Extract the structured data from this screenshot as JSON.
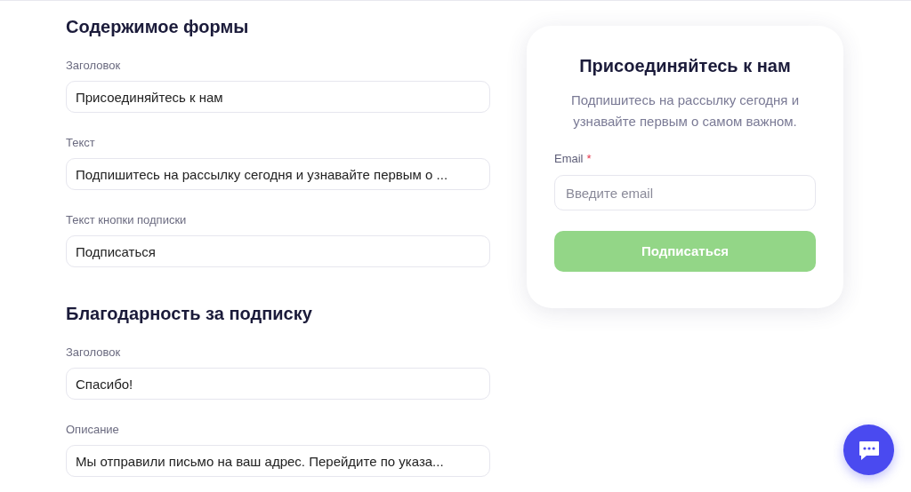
{
  "sections": [
    {
      "title": "Содержимое формы",
      "fields": [
        {
          "label": "Заголовок",
          "value": "Присоединяйтесь к нам"
        },
        {
          "label": "Текст",
          "value": "Подпишитесь на рассылку сегодня и узнавайте первым о ..."
        },
        {
          "label": "Текст кнопки подписки",
          "value": "Подписаться"
        }
      ]
    },
    {
      "title": "Благодарность за подписку",
      "fields": [
        {
          "label": "Заголовок",
          "value": "Спасибо!"
        },
        {
          "label": "Описание",
          "value": "Мы отправили письмо на ваш адрес. Перейдите по указа..."
        }
      ]
    }
  ],
  "preview": {
    "title": "Присоединяйтесь к нам",
    "text": "Подпишитесь на рассылку сегодня и узнавайте первым о самом важном.",
    "email_label": "Email",
    "required_mark": "*",
    "email_placeholder": "Введите email",
    "button": "Подписаться"
  }
}
